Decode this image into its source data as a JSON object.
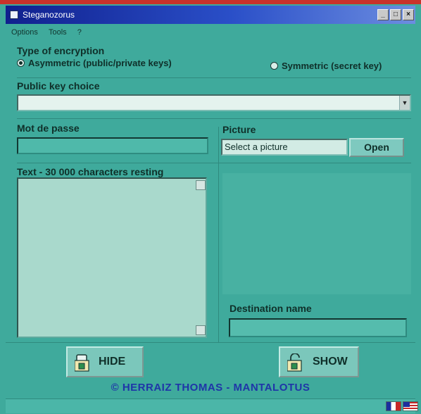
{
  "window": {
    "title": "Steganozorus"
  },
  "menu": {
    "items": [
      "Options",
      "Tools",
      "?"
    ]
  },
  "encryption": {
    "label": "Type of encryption",
    "asymmetric_label": "Asymmetric (public/private keys)",
    "symmetric_label": "Symmetric (secret key)",
    "selected": "asymmetric"
  },
  "public_key": {
    "label": "Public key choice",
    "value": ""
  },
  "password": {
    "label": "Mot de passe",
    "value": ""
  },
  "picture": {
    "label": "Picture",
    "value": "Select a picture",
    "open_label": "Open"
  },
  "text": {
    "label": "Text - 30 000 characters resting",
    "value": ""
  },
  "destination": {
    "label": "Destination name",
    "value": ""
  },
  "actions": {
    "hide_label": "HIDE",
    "show_label": "SHOW"
  },
  "credit": "© HERRAIZ THOMAS - MANTALOTUS",
  "icons": {
    "app": "steganography-app-icon",
    "hide": "padlock-folder-icon",
    "show": "open-padlock-folder-icon",
    "language_fr": "french-flag-icon",
    "language_en": "english-flag-icon"
  },
  "colors": {
    "window_bg": "#3faa9c",
    "titlebar": "#10208e",
    "credit": "#1f35a8",
    "accent_frame": "#c8322b"
  }
}
